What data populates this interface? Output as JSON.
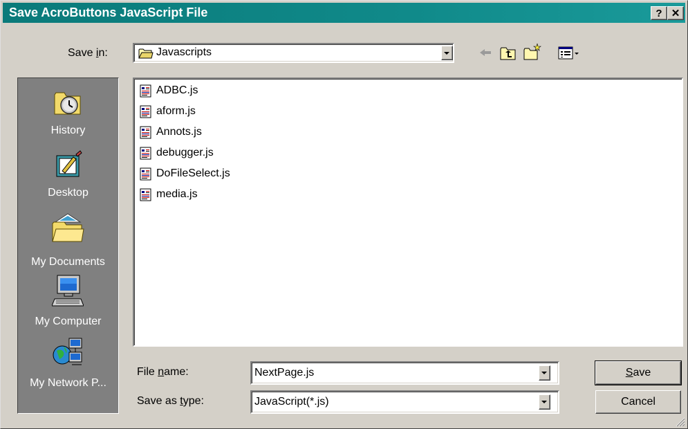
{
  "window": {
    "title": "Save AcroButtons JavaScript File",
    "help_button": "?",
    "close_button": "✕"
  },
  "save_in": {
    "label_pre": "Save ",
    "label_ul": "i",
    "label_post": "n:",
    "folder": "Javascripts"
  },
  "toolbar": {
    "icons": [
      "back-icon",
      "up-one-level-icon",
      "new-folder-icon",
      "view-menu-icon"
    ]
  },
  "places": [
    {
      "label": "History",
      "icon": "history-icon"
    },
    {
      "label": "Desktop",
      "icon": "desktop-icon"
    },
    {
      "label": "My Documents",
      "icon": "my-documents-icon"
    },
    {
      "label": "My Computer",
      "icon": "my-computer-icon"
    },
    {
      "label": "My Network P...",
      "icon": "my-network-places-icon"
    }
  ],
  "files": [
    "ADBC.js",
    "aform.js",
    "Annots.js",
    "debugger.js",
    "DoFileSelect.js",
    "media.js"
  ],
  "file_name": {
    "label_pre": "File ",
    "label_ul": "n",
    "label_post": "ame:",
    "value": "NextPage.js"
  },
  "save_as_type": {
    "label_pre": "Save as ",
    "label_ul": "t",
    "label_post": "ype:",
    "value": "JavaScript(*.js)"
  },
  "buttons": {
    "save_ul": "S",
    "save_rest": "ave",
    "cancel": "Cancel"
  },
  "colors": {
    "titlebar": "#0a7a7a",
    "dialog_face": "#d4d0c8",
    "places_bar": "#808080"
  }
}
